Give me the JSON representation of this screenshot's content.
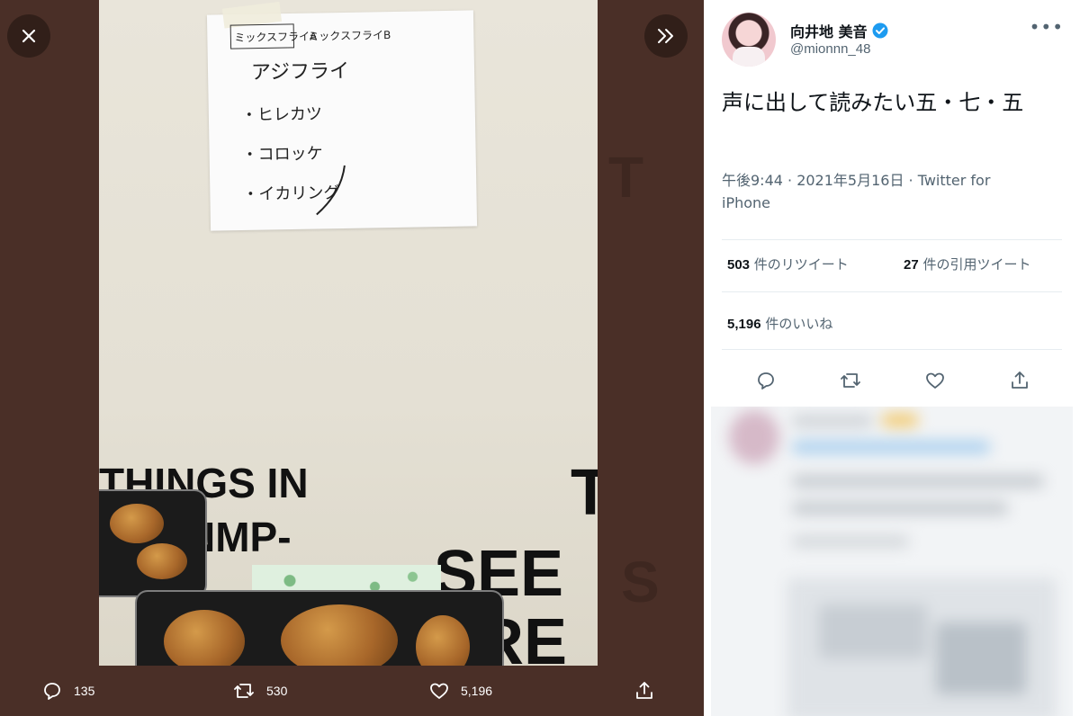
{
  "viewer": {
    "close_icon": "close-icon",
    "expand_icon": "chevrons-right-icon",
    "photo": {
      "note_lines": [
        "ミックスフライA",
        "ミックスフライB",
        "アジフライ",
        "・ヒレカツ",
        "・コロッケ",
        "・イカリング"
      ],
      "wall_text_1": "THINGS IN",
      "wall_text_2": "NMP-",
      "wall_text_3": "SEE",
      "wall_text_4": "RE",
      "wall_text_5": "T"
    },
    "actions": {
      "reply_count": "135",
      "retweet_count": "530",
      "like_count": "5,196"
    }
  },
  "tweet": {
    "display_name": "向井地 美音",
    "handle": "@mionnn_48",
    "text": "声に出して読みたい五・七・五",
    "timestamp": "午後9:44 · 2021年5月16日 · Twitter for iPhone",
    "retweets": {
      "count": "503",
      "label": " 件のリツイート"
    },
    "quotes": {
      "count": "27",
      "label": " 件の引用ツイート"
    },
    "likes": {
      "count": "5,196",
      "label": " 件のいいね"
    },
    "verified_color": "#1d9bf0",
    "action_color": "#536471"
  }
}
